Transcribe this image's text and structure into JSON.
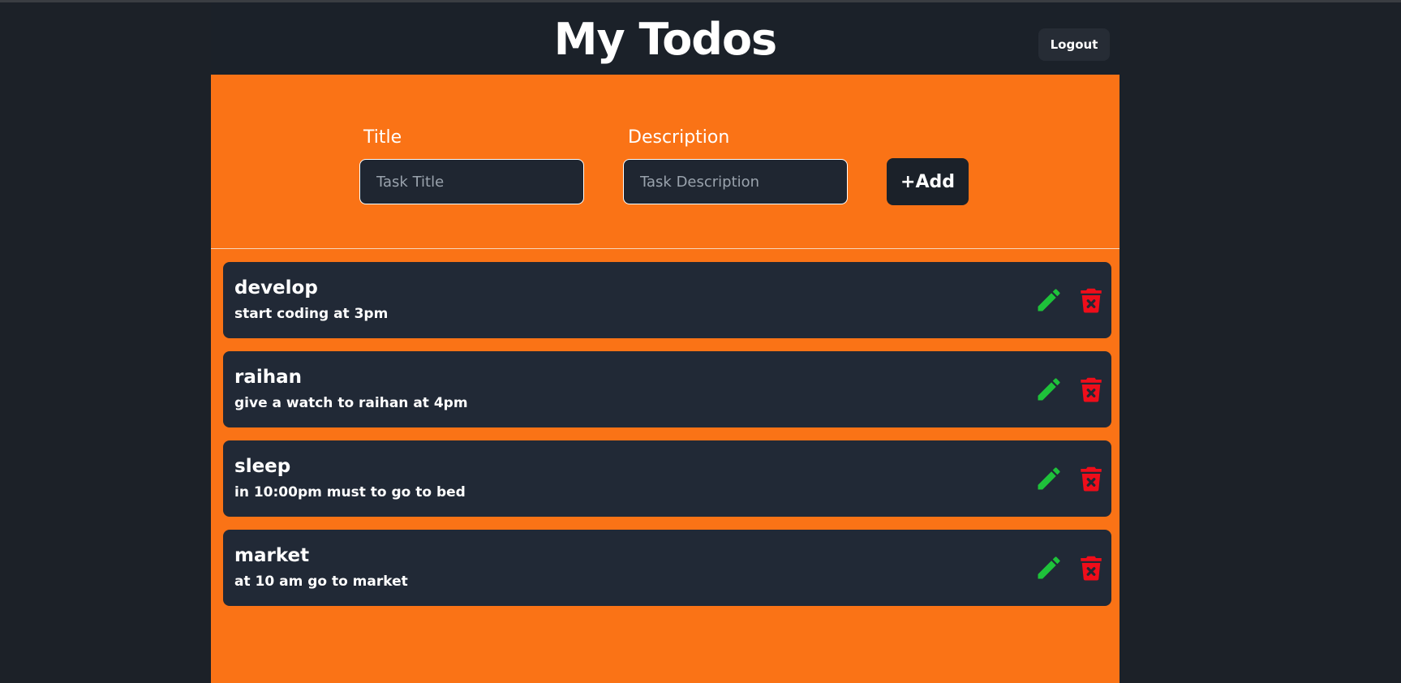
{
  "header": {
    "title": "My Todos",
    "logout_label": "Logout"
  },
  "form": {
    "title_label": "Title",
    "title_placeholder": "Task Title",
    "title_value": "",
    "description_label": "Description",
    "description_placeholder": "Task Description",
    "description_value": "",
    "add_label": "+Add"
  },
  "todos": [
    {
      "title": "develop",
      "description": "start coding at 3pm"
    },
    {
      "title": "raihan",
      "description": "give a watch to raihan at 4pm"
    },
    {
      "title": "sleep",
      "description": "in 10:00pm must to go to bed"
    },
    {
      "title": "market",
      "description": "at 10 am go to market"
    }
  ],
  "icons": {
    "edit": "pencil-icon",
    "delete": "trash-icon"
  },
  "colors": {
    "page_background": "#1c2128",
    "accent": "#fa7316",
    "card": "#212936",
    "edit": "#1ec23a",
    "delete": "#ef0d1a"
  }
}
